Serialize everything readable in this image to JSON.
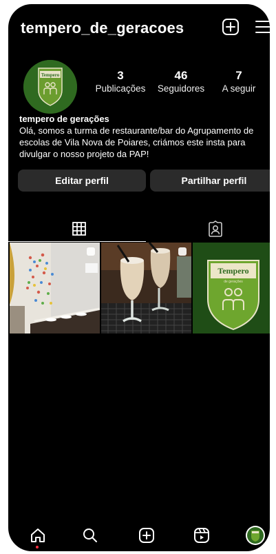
{
  "profile": {
    "username": "tempero_de_geracoes",
    "avatar_brand": "Tempero",
    "avatar_sub": "de gerações",
    "stats": [
      {
        "value": "3",
        "label": "Publicações"
      },
      {
        "value": "46",
        "label": "Seguidores"
      },
      {
        "value": "7",
        "label": "A seguir"
      }
    ],
    "display_name": "tempero de gerações",
    "bio": "Olá, somos a turma de restaurante/bar do Agrupamento de escolas de Vila Nova de Poiares, criámos este insta para divulgar o nosso projeto da PAP!"
  },
  "buttons": {
    "edit": "Editar perfil",
    "share": "Partilhar perfil"
  },
  "tabs": [
    {
      "icon": "grid-icon",
      "active": true
    },
    {
      "icon": "tagged-icon",
      "active": false
    }
  ],
  "posts": [
    {
      "description_icon": "restaurant-wall-photo",
      "multi": true
    },
    {
      "description_icon": "milkshake-glasses-photo",
      "multi": true
    },
    {
      "description_icon": "tempero-logo-photo",
      "multi": false
    }
  ],
  "post_logo": {
    "brand": "Tempero",
    "sub": "de gerações"
  },
  "nav": [
    "home-icon",
    "search-icon",
    "create-icon",
    "reels-icon",
    "profile-avatar"
  ],
  "colors": {
    "background": "#000000",
    "button": "#2b2b2b",
    "brand_green": "#2f6a20",
    "notification": "#ff3040"
  }
}
